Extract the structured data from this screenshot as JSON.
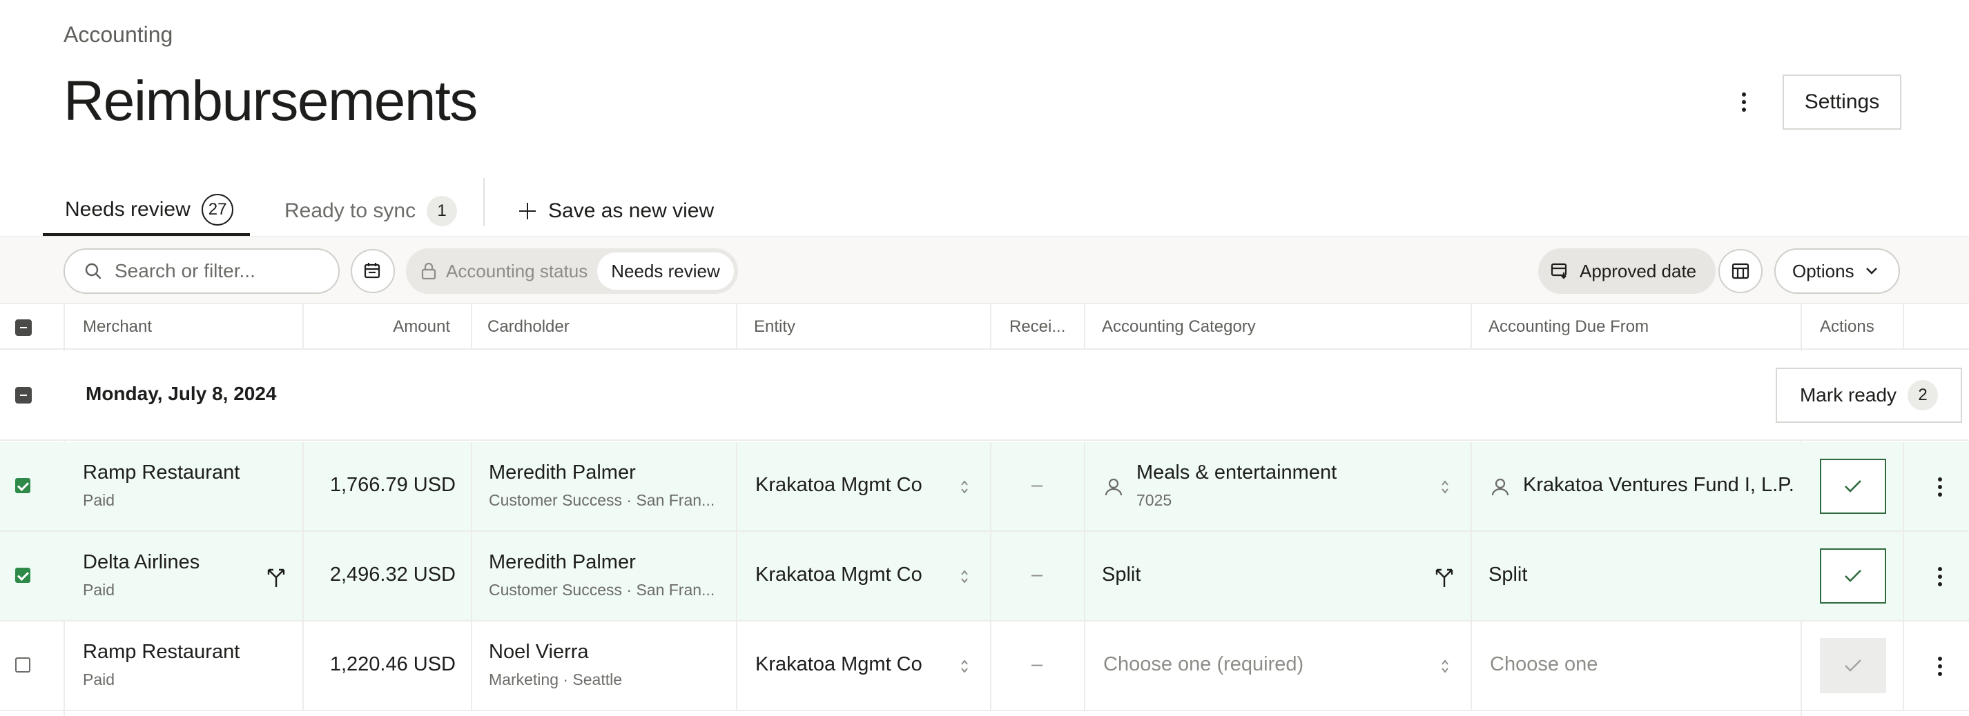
{
  "header": {
    "breadcrumb": "Accounting",
    "title": "Reimbursements",
    "settings_label": "Settings"
  },
  "tabs": [
    {
      "label": "Needs review",
      "count": "27",
      "active": true
    },
    {
      "label": "Ready to sync",
      "count": "1",
      "active": false
    }
  ],
  "save_view_label": "Save as new view",
  "toolbar": {
    "search_placeholder": "Search or filter...",
    "filter_key": "Accounting status",
    "filter_value": "Needs review",
    "approved_date_label": "Approved date",
    "options_label": "Options"
  },
  "columns": {
    "merchant": "Merchant",
    "amount": "Amount",
    "cardholder": "Cardholder",
    "entity": "Entity",
    "receipt": "Recei...",
    "category": "Accounting Category",
    "due_from": "Accounting Due From",
    "actions": "Actions"
  },
  "group": {
    "date": "Monday, July 8, 2024",
    "mark_ready_label": "Mark ready",
    "mark_ready_count": "2"
  },
  "rows": [
    {
      "merchant": "Ramp Restaurant",
      "status": "Paid",
      "amount": "1,766.79 USD",
      "cardholder": "Meredith Palmer",
      "cardholder_detail": "Customer Success · San Fran...",
      "entity": "Krakatoa Mgmt Co",
      "receipt": "–",
      "category": "Meals & entertainment",
      "category_code": "7025",
      "due_from": "Krakatoa Ventures Fund I, L.P.",
      "selected": true
    },
    {
      "merchant": "Delta Airlines",
      "status": "Paid",
      "amount": "2,496.32 USD",
      "cardholder": "Meredith Palmer",
      "cardholder_detail": "Customer Success · San Fran...",
      "entity": "Krakatoa Mgmt Co",
      "receipt": "–",
      "category": "Split",
      "category_code": "",
      "due_from": "Split",
      "selected": true
    },
    {
      "merchant": "Ramp Restaurant",
      "status": "Paid",
      "amount": "1,220.46 USD",
      "cardholder": "Noel Vierra",
      "cardholder_detail": "Marketing · Seattle",
      "entity": "Krakatoa Mgmt Co",
      "receipt": "–",
      "category": "Choose one (required)",
      "category_code": "",
      "due_from": "Choose one",
      "selected": false
    }
  ],
  "colors": {
    "selected_row_bg": "#f1fbf5",
    "checkbox_green": "#2f8a4a",
    "action_border": "#2f6a3e"
  }
}
